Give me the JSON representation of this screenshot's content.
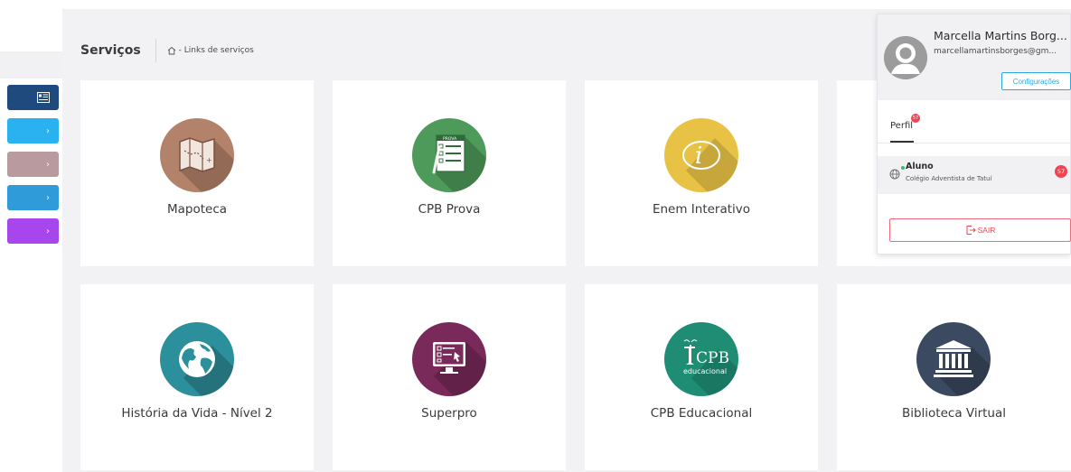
{
  "header": {
    "title": "Serviços",
    "breadcrumb": "- Links de serviços",
    "home_icon": "home-icon"
  },
  "sidebar": {
    "items": [
      {
        "icon": "id-card-icon",
        "color": "#1e4a7e"
      },
      {
        "icon": "chevron-right-icon",
        "color": "#2ab2f0"
      },
      {
        "icon": "chevron-right-icon",
        "color": "#b89a9f"
      },
      {
        "icon": "chevron-right-icon",
        "color": "#2f9bd9"
      },
      {
        "icon": "chevron-right-icon",
        "color": "#a646ec"
      }
    ]
  },
  "services": [
    {
      "label": "Mapoteca",
      "icon": "map-icon",
      "color": "#b3826a"
    },
    {
      "label": "CPB Prova",
      "icon": "exam-sheet-icon",
      "color": "#4d9a5a"
    },
    {
      "label": "Enem Interativo",
      "icon": "info-icon",
      "color": "#e8c245"
    },
    {
      "label": "",
      "icon": "hidden-service-icon",
      "color": "#cccccc"
    },
    {
      "label": "História da Vida - Nível 2",
      "icon": "globe-icon",
      "color": "#2c8f9c"
    },
    {
      "label": "Superpro",
      "icon": "monitor-checklist-icon",
      "color": "#7a2a5a"
    },
    {
      "label": "CPB Educacional",
      "icon": "cpb-logo-icon",
      "color": "#1f8c74",
      "logo_text": "CPB",
      "logo_subtext": "educacional"
    },
    {
      "label": "Biblioteca Virtual",
      "icon": "library-building-icon",
      "color": "#3b4a60"
    }
  ],
  "profile": {
    "name": "Marcella Martins Borg...",
    "email": "marcellamartinsborges@gm...",
    "settings_label": "Configurações",
    "tab_label": "Perfil",
    "tab_badge": "57",
    "role": {
      "title": "Aluno",
      "school": "Colégio Adventista de Tatuí",
      "badge": "57"
    },
    "logout_label": "SAIR"
  }
}
